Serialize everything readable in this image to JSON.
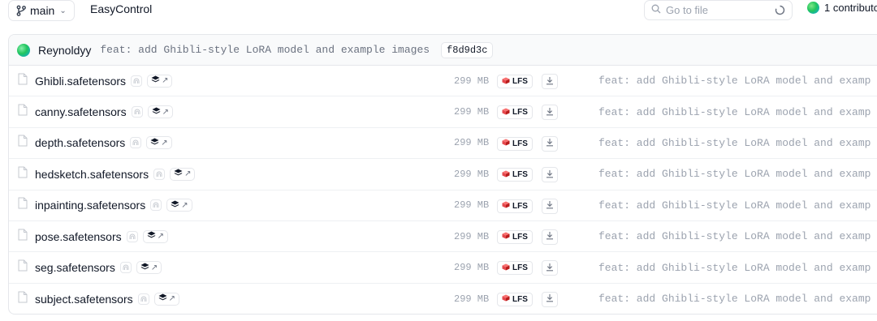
{
  "branch": {
    "label": "main"
  },
  "repo": {
    "name": "EasyControl"
  },
  "search": {
    "placeholder": "Go to file"
  },
  "contributors": {
    "label": "1 contributo"
  },
  "last_commit": {
    "author": "Reynoldyy",
    "message": "feat: add Ghibli-style LoRA model and example images",
    "hash": "f8d9d3c"
  },
  "colors": {
    "lfs_red": "#e5484d",
    "avatar_green": "#22c55e"
  },
  "files": [
    {
      "name": "Ghibli.safetensors",
      "size": "299 MB",
      "lfs": "LFS",
      "commit": "feat: add Ghibli-style LoRA model and examp"
    },
    {
      "name": "canny.safetensors",
      "size": "299 MB",
      "lfs": "LFS",
      "commit": "feat: add Ghibli-style LoRA model and examp"
    },
    {
      "name": "depth.safetensors",
      "size": "299 MB",
      "lfs": "LFS",
      "commit": "feat: add Ghibli-style LoRA model and examp"
    },
    {
      "name": "hedsketch.safetensors",
      "size": "299 MB",
      "lfs": "LFS",
      "commit": "feat: add Ghibli-style LoRA model and examp"
    },
    {
      "name": "inpainting.safetensors",
      "size": "299 MB",
      "lfs": "LFS",
      "commit": "feat: add Ghibli-style LoRA model and examp"
    },
    {
      "name": "pose.safetensors",
      "size": "299 MB",
      "lfs": "LFS",
      "commit": "feat: add Ghibli-style LoRA model and examp"
    },
    {
      "name": "seg.safetensors",
      "size": "299 MB",
      "lfs": "LFS",
      "commit": "feat: add Ghibli-style LoRA model and examp"
    },
    {
      "name": "subject.safetensors",
      "size": "299 MB",
      "lfs": "LFS",
      "commit": "feat: add Ghibli-style LoRA model and examp"
    }
  ]
}
